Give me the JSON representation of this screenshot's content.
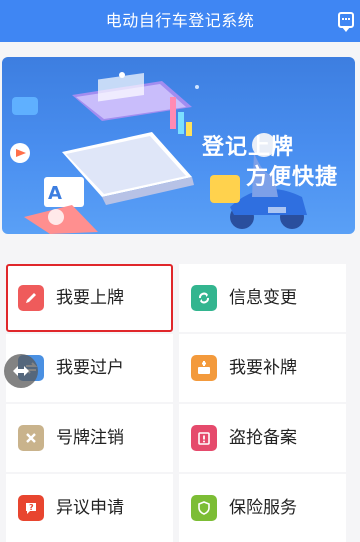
{
  "header": {
    "title": "电动自行车登记系统",
    "chat_icon": "chat-icon"
  },
  "banner": {
    "line1": "登记上牌",
    "line2": "方便快捷",
    "slide_count": 3,
    "active_slide": 1
  },
  "menu": [
    {
      "label": "我要上牌",
      "icon": "pen-icon",
      "color": "#ef5b5b",
      "selected": true
    },
    {
      "label": "信息变更",
      "icon": "refresh-icon",
      "color": "#33b58f",
      "selected": false
    },
    {
      "label": "我要过户",
      "icon": "transfer-icon",
      "color": "#4a90e2",
      "selected": false
    },
    {
      "label": "我要补牌",
      "icon": "plate-add-icon",
      "color": "#f39a3c",
      "selected": false
    },
    {
      "label": "号牌注销",
      "icon": "close-icon",
      "color": "#c9b38c",
      "selected": false
    },
    {
      "label": "盗抢备案",
      "icon": "clipboard-alert-icon",
      "color": "#e54a6c",
      "selected": false
    },
    {
      "label": "异议申请",
      "icon": "objection-icon",
      "color": "#e8452f",
      "selected": false
    },
    {
      "label": "保险服务",
      "icon": "shield-icon",
      "color": "#7cbd35",
      "selected": false
    }
  ],
  "floating_button": {
    "icon": "drag-handle-icon"
  }
}
